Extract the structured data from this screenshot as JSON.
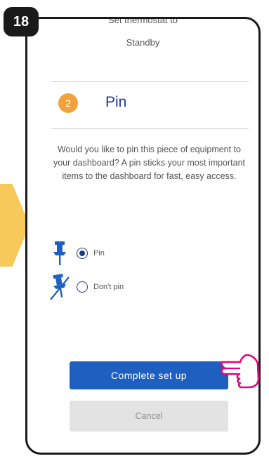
{
  "step_number": "18",
  "previous_section": {
    "text_cut": "Set thermostat to",
    "text": "Standby"
  },
  "section": {
    "number": "2",
    "title": "Pin"
  },
  "description": "Would you like to pin this piece of equipment to your dashboard? A pin sticks your most important items to the dashboard for fast, easy access.",
  "options": [
    {
      "label": "Pin",
      "icon": "pin-icon",
      "selected": true
    },
    {
      "label": "Don't pin",
      "icon": "pin-off-icon",
      "selected": false
    }
  ],
  "buttons": {
    "complete": "Complete set up",
    "cancel": "Cancel"
  },
  "colors": {
    "accent_blue": "#1f5fbf",
    "dark_blue": "#1f3c8b",
    "orange": "#f2a23a",
    "yellow_arrow": "#f7c95a",
    "pink": "#e5007d"
  }
}
